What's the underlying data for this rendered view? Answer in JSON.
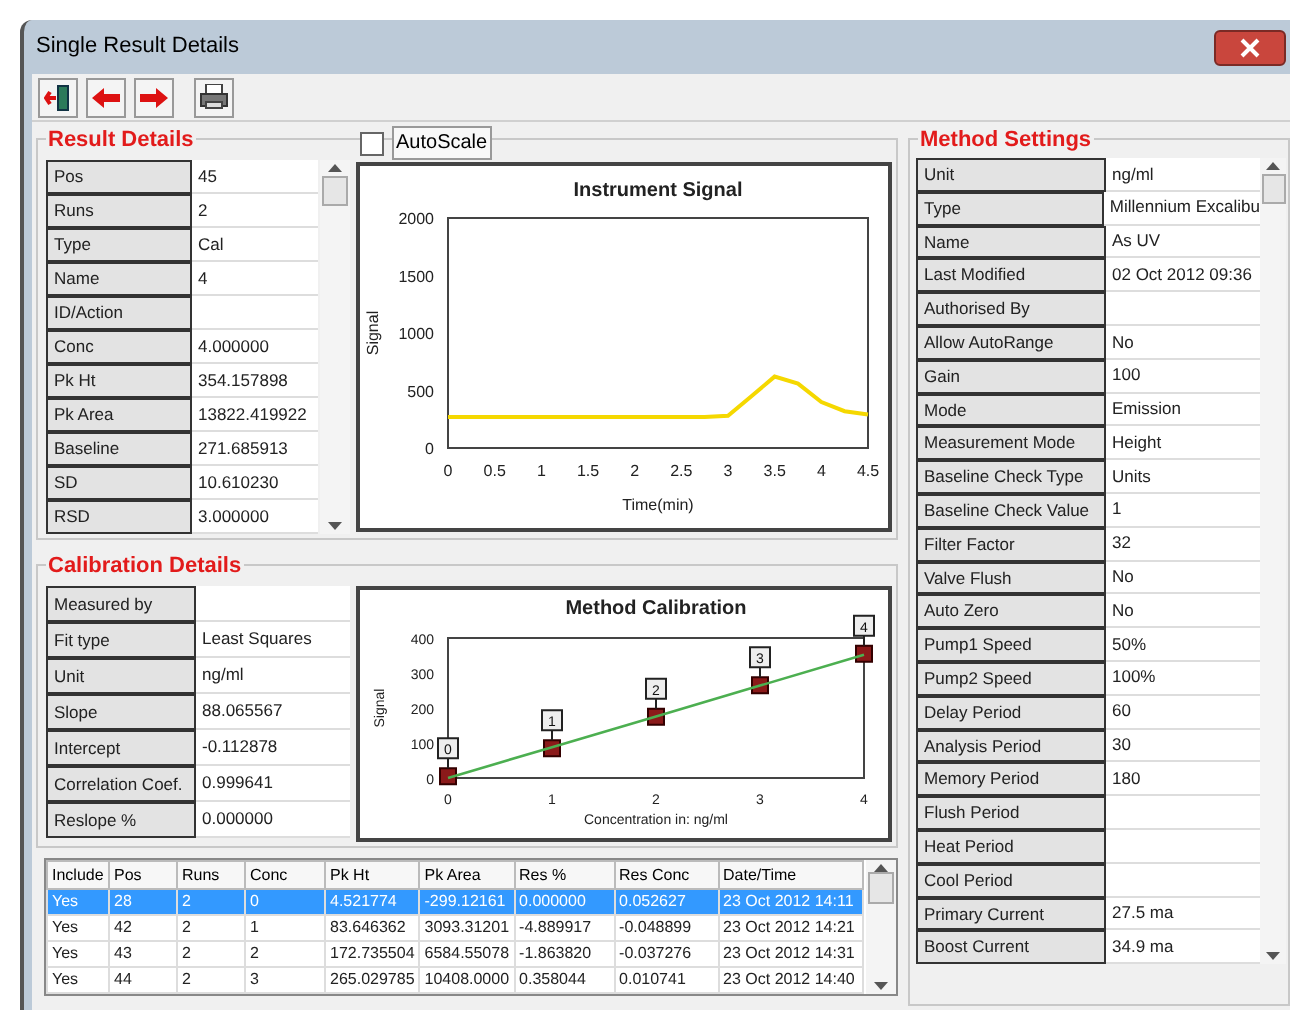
{
  "window": {
    "title": "Single Result Details"
  },
  "result_details": {
    "title": "Result Details",
    "rows": [
      {
        "label": "Pos",
        "value": "45"
      },
      {
        "label": "Runs",
        "value": "2"
      },
      {
        "label": "Type",
        "value": "Cal"
      },
      {
        "label": "Name",
        "value": "4"
      },
      {
        "label": "ID/Action"
      },
      {
        "label": "Conc",
        "value": "4.000000"
      },
      {
        "label": "Pk Ht",
        "value": "354.157898"
      },
      {
        "label": "Pk Area",
        "value": "13822.419922"
      },
      {
        "label": "Baseline",
        "value": "271.685913"
      },
      {
        "label": "SD",
        "value": "10.610230"
      },
      {
        "label": "RSD",
        "value": "3.000000"
      }
    ]
  },
  "autoscale": {
    "label": "AutoScale",
    "checked": false
  },
  "instrument_signal": {
    "chart_data": {
      "type": "line",
      "title": "Instrument Signal",
      "xlabel": "Time(min)",
      "ylabel": "Signal",
      "x": [
        0,
        0.25,
        0.5,
        0.75,
        1,
        1.25,
        1.5,
        1.75,
        2,
        2.25,
        2.5,
        2.75,
        3,
        3.25,
        3.5,
        3.75,
        4,
        4.25,
        4.5
      ],
      "series": [
        {
          "color": "#f5d800",
          "values": [
            270,
            270,
            270,
            270,
            270,
            270,
            270,
            270,
            270,
            270,
            270,
            270,
            280,
            450,
            620,
            560,
            400,
            320,
            290
          ]
        }
      ],
      "xlim": [
        0,
        4.5
      ],
      "ylim": [
        0,
        2000
      ],
      "xticks": [
        0,
        0.5,
        1,
        1.5,
        2,
        2.5,
        3,
        3.5,
        4,
        4.5
      ],
      "yticks": [
        0,
        500,
        1000,
        1500,
        2000
      ]
    }
  },
  "calibration_details": {
    "title": "Calibration Details",
    "rows": [
      {
        "label": "Measured by"
      },
      {
        "label": "Fit type",
        "value": "Least Squares"
      },
      {
        "label": "Unit",
        "value": "ng/ml"
      },
      {
        "label": "Slope",
        "value": "88.065567"
      },
      {
        "label": "Intercept",
        "value": "-0.112878"
      },
      {
        "label": "Correlation Coef.",
        "value": "0.999641"
      },
      {
        "label": "Reslope %",
        "value": "0.000000"
      }
    ]
  },
  "method_calibration": {
    "chart_data": {
      "type": "scatter",
      "title": "Method Calibration",
      "xlabel": "Concentration in: ng/ml",
      "ylabel": "Signal",
      "x": [
        0,
        1,
        2,
        3,
        4
      ],
      "series": [
        {
          "color": "#8b1a1a",
          "values": [
            5,
            85,
            175,
            265,
            355
          ]
        },
        {
          "type": "line",
          "color": "#4caf50",
          "values": [
            0,
            88,
            176,
            264,
            352
          ]
        }
      ],
      "value_labels": [
        "0",
        "1",
        "2",
        "3",
        "4"
      ],
      "xlim": [
        0,
        4
      ],
      "ylim": [
        0,
        400
      ],
      "xticks": [
        0,
        1,
        2,
        3,
        4
      ],
      "yticks": [
        0,
        100,
        200,
        300,
        400
      ]
    }
  },
  "results_table": {
    "columns": [
      "Include",
      "Pos",
      "Runs",
      "Conc",
      "Pk Ht",
      "Pk Area",
      "Res %",
      "Res Conc",
      "Date/Time"
    ],
    "rows": [
      {
        "selected": true,
        "cells": [
          "Yes",
          "28",
          "2",
          "0",
          "4.521774",
          "-299.12161",
          "0.000000",
          "0.052627",
          "23 Oct 2012 14:11"
        ]
      },
      {
        "selected": false,
        "cells": [
          "Yes",
          "42",
          "2",
          "1",
          "83.646362",
          "3093.31201",
          "-4.889917",
          "-0.048899",
          "23 Oct 2012 14:21"
        ]
      },
      {
        "selected": false,
        "cells": [
          "Yes",
          "43",
          "2",
          "2",
          "172.735504",
          "6584.55078",
          "-1.863820",
          "-0.037276",
          "23 Oct 2012 14:31"
        ]
      },
      {
        "selected": false,
        "cells": [
          "Yes",
          "44",
          "2",
          "3",
          "265.029785",
          "10408.0000",
          "0.358044",
          "0.010741",
          "23 Oct 2012 14:40"
        ]
      }
    ]
  },
  "method_settings": {
    "title": "Method Settings",
    "rows": [
      {
        "label": "Unit",
        "value": "ng/ml"
      },
      {
        "label": "Type",
        "value": "Millennium Excalibu"
      },
      {
        "label": "Name",
        "value": "As UV"
      },
      {
        "label": "Last Modified",
        "value": "02 Oct 2012 09:36"
      },
      {
        "label": "Authorised By"
      },
      {
        "label": "Allow AutoRange",
        "value": "No"
      },
      {
        "label": "Gain",
        "value": "100"
      },
      {
        "label": "Mode",
        "value": "Emission"
      },
      {
        "label": "Measurement Mode",
        "value": "Height"
      },
      {
        "label": "Baseline Check Type",
        "value": "Units"
      },
      {
        "label": "Baseline Check Value",
        "value": "1"
      },
      {
        "label": "Filter Factor",
        "value": "32"
      },
      {
        "label": "Valve Flush",
        "value": "No"
      },
      {
        "label": "Auto Zero",
        "value": "No"
      },
      {
        "label": "Pump1 Speed",
        "value": "50%"
      },
      {
        "label": "Pump2 Speed",
        "value": "100%"
      },
      {
        "label": "Delay Period",
        "value": "60"
      },
      {
        "label": "Analysis Period",
        "value": "30"
      },
      {
        "label": "Memory Period",
        "value": "180"
      },
      {
        "label": "Flush Period"
      },
      {
        "label": "Heat Period"
      },
      {
        "label": "Cool Period"
      },
      {
        "label": "Primary Current",
        "value": "27.5 ma"
      },
      {
        "label": "Boost Current",
        "value": "34.9 ma"
      }
    ]
  }
}
